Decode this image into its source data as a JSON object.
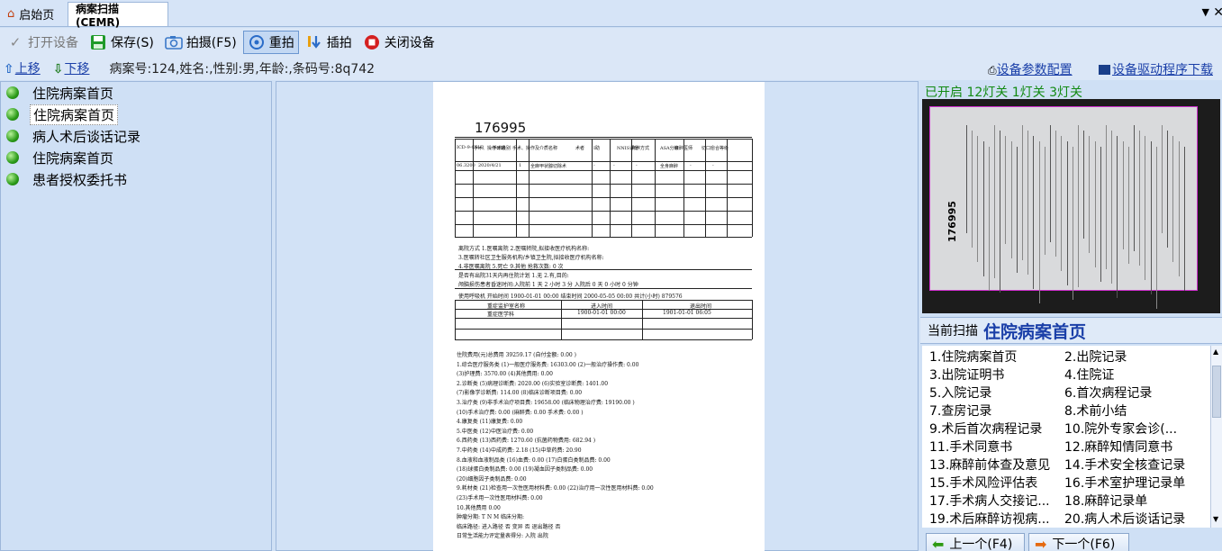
{
  "tabs": [
    {
      "label": "启始页"
    },
    {
      "label": "病案扫描(CEMR)"
    }
  ],
  "toolbar": {
    "open_device": "打开设备",
    "save": "保存(S)",
    "capture": "拍摄(F5)",
    "reshoot": "重拍",
    "insert": "插拍",
    "close_device": "关闭设备"
  },
  "infobar": {
    "move_up": "上移",
    "move_down": "下移",
    "patient_info": "病案号:124,姓名:,性别:男,年龄:,条码号:8q742",
    "device_config": "设备参数配置",
    "driver_download": "设备驱动程序下载"
  },
  "scanned_pages": [
    {
      "label": "住院病案首页",
      "selected": false
    },
    {
      "label": "住院病案首页",
      "selected": true
    },
    {
      "label": "病人术后谈话记录",
      "selected": false
    },
    {
      "label": "住院病案首页",
      "selected": false
    },
    {
      "label": "患者授权委托书",
      "selected": false
    }
  ],
  "document": {
    "number": "176995",
    "header_cols": [
      "ICD-9-CM-3",
      "手术、操作日期",
      "手术级别",
      "手术、操作及介质名称",
      "术者",
      "I助",
      "NNIS评分",
      "麻醉方式",
      "ASA分级",
      "麻醉医师",
      "切口愈合等级"
    ],
    "row1": [
      "06.3200",
      "2020/4/21",
      "1",
      "全麻甲状腺切除术",
      "-",
      "-",
      "-",
      "全身麻醉",
      "-",
      "-"
    ],
    "discharge_line": "离院方式  1.医嘱离院  2.医嘱转院,拟接收医疗机构名称:",
    "line2": "3.医嘱转社区卫生服务机构/乡镇卫生院,拟接收医疗机构名称:",
    "line3": "4.非医嘱离院  5.死亡  9.其他                 抢救次数:  0          次",
    "line4": "是否有出院31天内再住院计划  1.无  2.有,目的:",
    "line5": "颅脑损伤患者昏迷时间:入院前  1  天  2  小时  3  分  入院后  0  天  0  小时  0  分钟",
    "line6": "使用呼吸机  开始时间  1900-01-01 00:00    结束时间  2000-05-05 00:00    共计(小时) 879576",
    "icu_cols": [
      "重症监护室名称",
      "进入时间",
      "退出时间"
    ],
    "icu_row": [
      "重症医学科",
      "1900-01-01 00:00",
      "1901-01-01 06:05"
    ],
    "fee_lines": [
      "住院费用(元)总费用    39259.17      (自付金额:  0.00            )",
      "1.综合医疗服务类   (1)一般医疗服务费: 16303.00    (2)一般治疗操作费: 0.00",
      "                    (3)护理费: 3570.00      (4)其他费用: 0.00",
      "2.诊断类   (5)病理诊断费: 2020.00    (6)实验室诊断费: 1401.00",
      "           (7)影像学诊断费: 114.00     (8)临床诊断项目费: 0.00",
      "3.治疗类   (9)非手术治疗项目费: 19658.00    (临床物理治疗费: 19190.00 )",
      "           (10)手术治疗费: 0.00     (麻醉费: 0.00     手术费: 0.00     )",
      "4.康复类   (11)康复费: 0.00",
      "5.中医类   (12)中医治疗费: 0.00",
      "6.西药类   (13)西药费: 1270.60      (抗菌药物费用: 682.94     )",
      "7.中药类   (14)中成药费: 2.18          (15)中草药费: 20.90",
      "8.血液和血液制品类   (16)血费: 0.00        (17)白蛋白类制品费: 0.00",
      "           (18)球蛋白类制品费: 0.00      (19)凝血因子类制品费: 0.00",
      "           (20)细胞因子类制品费: 0.00",
      "9.耗材类   (21)检查用一次性医用材料费: 0.00      (22)治疗用一次性医用材料费: 0.00",
      "           (23)手术用一次性医用材料费: 0.00",
      "10.其他费用   0.00",
      "肿瘤分期:  T           N                M           临床分期:",
      "临床路径:  进入路径  否           变异  否              退出路径  否",
      "日常生活能力评定量表得分:              入院              出院"
    ]
  },
  "preview": {
    "status": "已开启  12灯关  1灯关  3灯关",
    "page_number": "176995"
  },
  "current_scan": {
    "label": "当前扫描",
    "value": "住院病案首页"
  },
  "doc_types": [
    "1.住院病案首页",
    "2.出院记录",
    "3.出院证明书",
    "4.住院证",
    "5.入院记录",
    "6.首次病程记录",
    "7.查房记录",
    "8.术前小结",
    "9.术后首次病程记录",
    "10.院外专家会诊(...",
    "11.手术同意书",
    "12.麻醉知情同意书",
    "13.麻醉前体查及意见",
    "14.手术安全核查记录",
    "15.手术风险评估表",
    "16.手术室护理记录单",
    "17.手术病人交接记...",
    "18.麻醉记录单",
    "19.术后麻醉访视病...",
    "20.病人术后谈话记录"
  ],
  "nav": {
    "prev": "上一个(F4)",
    "next": "下一个(F6)"
  }
}
